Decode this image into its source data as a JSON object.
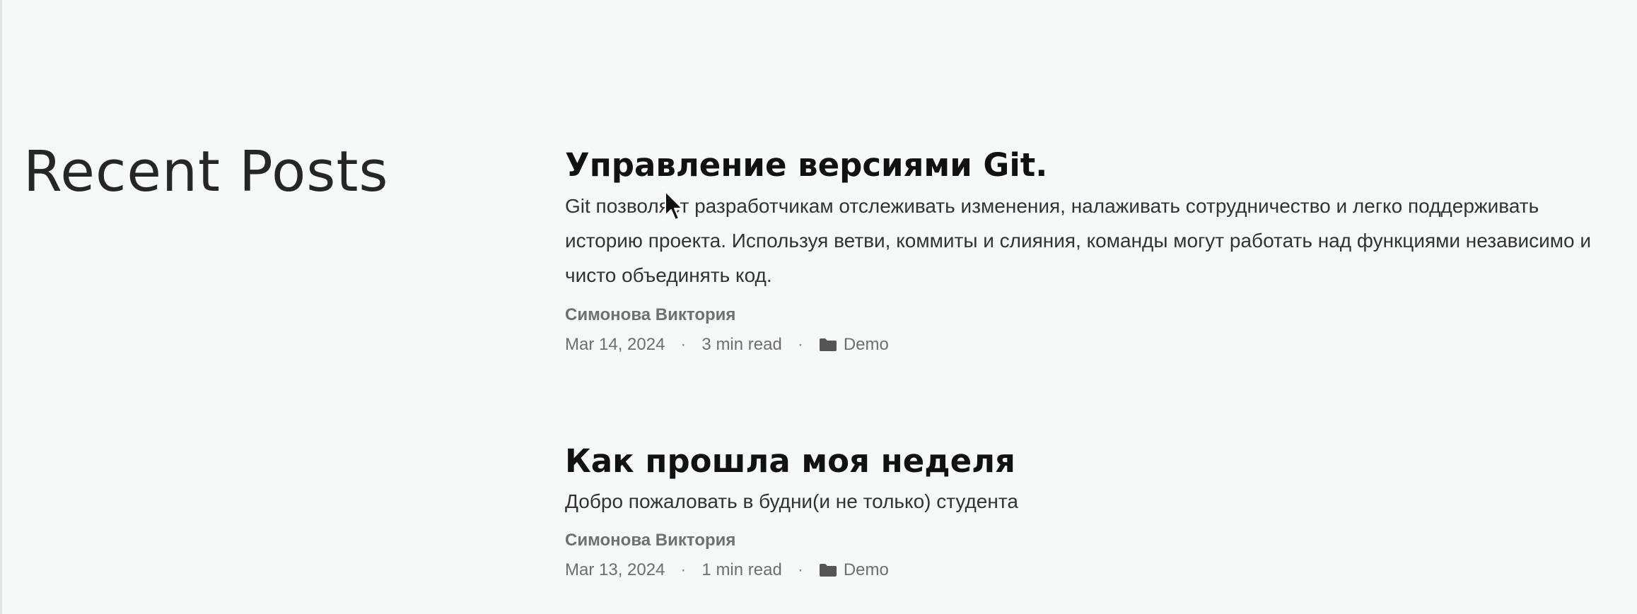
{
  "section": {
    "title": "Recent Posts"
  },
  "posts": [
    {
      "title": "Управление версиями Git.",
      "summary": "Git позволяет разработчикам отслеживать изменения, налаживать сотрудничество и легко поддерживать историю проекта. Используя ветви, коммиты и слияния, команды могут работать над функциями независимо и чисто объединять код.",
      "author": "Симонова Виктория",
      "date": "Mar 14, 2024",
      "read_time": "3 min read",
      "category": "Demo",
      "category_icon": "folder-icon"
    },
    {
      "title": "Как прошла моя неделя",
      "summary": "Добро пожаловать в будни(и не только) студента",
      "author": "Симонова Виктория",
      "date": "Mar 13, 2024",
      "read_time": "1 min read",
      "category": "Demo",
      "category_icon": "folder-icon"
    }
  ],
  "separator": "·",
  "colors": {
    "background": "#f6f9f7",
    "title": "#111111",
    "summary": "#333333",
    "meta": "#6e6e6e"
  }
}
